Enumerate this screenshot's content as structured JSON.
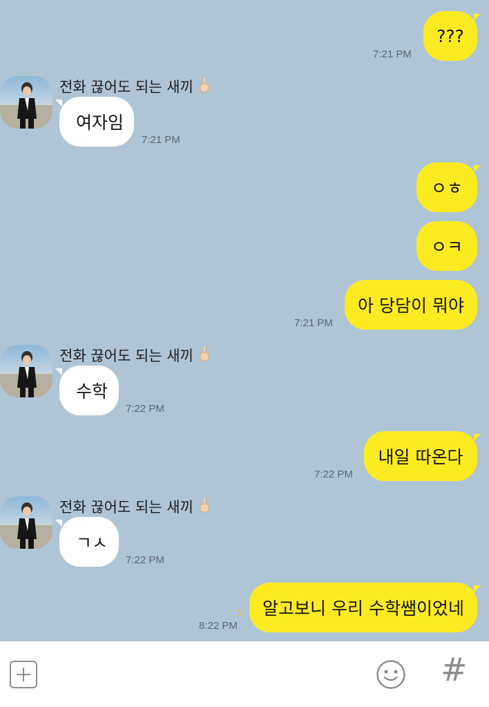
{
  "contact": {
    "name": "전화 끊어도 되는 새끼",
    "name_emoji": "middle-finger-emoji"
  },
  "messages": [
    {
      "from": "me",
      "text": "???",
      "time": "7:21 PM"
    },
    {
      "from": "them",
      "text": "여자임",
      "time": "7:21 PM"
    },
    {
      "from": "me",
      "text": "ㅇㅎ",
      "time": ""
    },
    {
      "from": "me",
      "text": "ㅇㅋ",
      "time": ""
    },
    {
      "from": "me",
      "text": "아 당담이 뭐야",
      "time": "7:21 PM"
    },
    {
      "from": "them",
      "text": "수학",
      "time": "7:22 PM"
    },
    {
      "from": "me",
      "text": "내일 따온다",
      "time": "7:22 PM"
    },
    {
      "from": "them",
      "text": "ㄱㅅ",
      "time": "7:22 PM"
    },
    {
      "from": "me",
      "text": "알고보니 우리 수학쌤이었네",
      "time": "8:22 PM",
      "unread": "1"
    }
  ],
  "input_bar": {
    "icons": [
      "plus-icon",
      "emoji-icon",
      "hashtag-icon"
    ],
    "hash_glyph": "#"
  },
  "colors": {
    "background": "#afc5d6",
    "my_bubble": "#fdeb22",
    "their_bubble": "#ffffff",
    "unread": "#e8c400"
  }
}
